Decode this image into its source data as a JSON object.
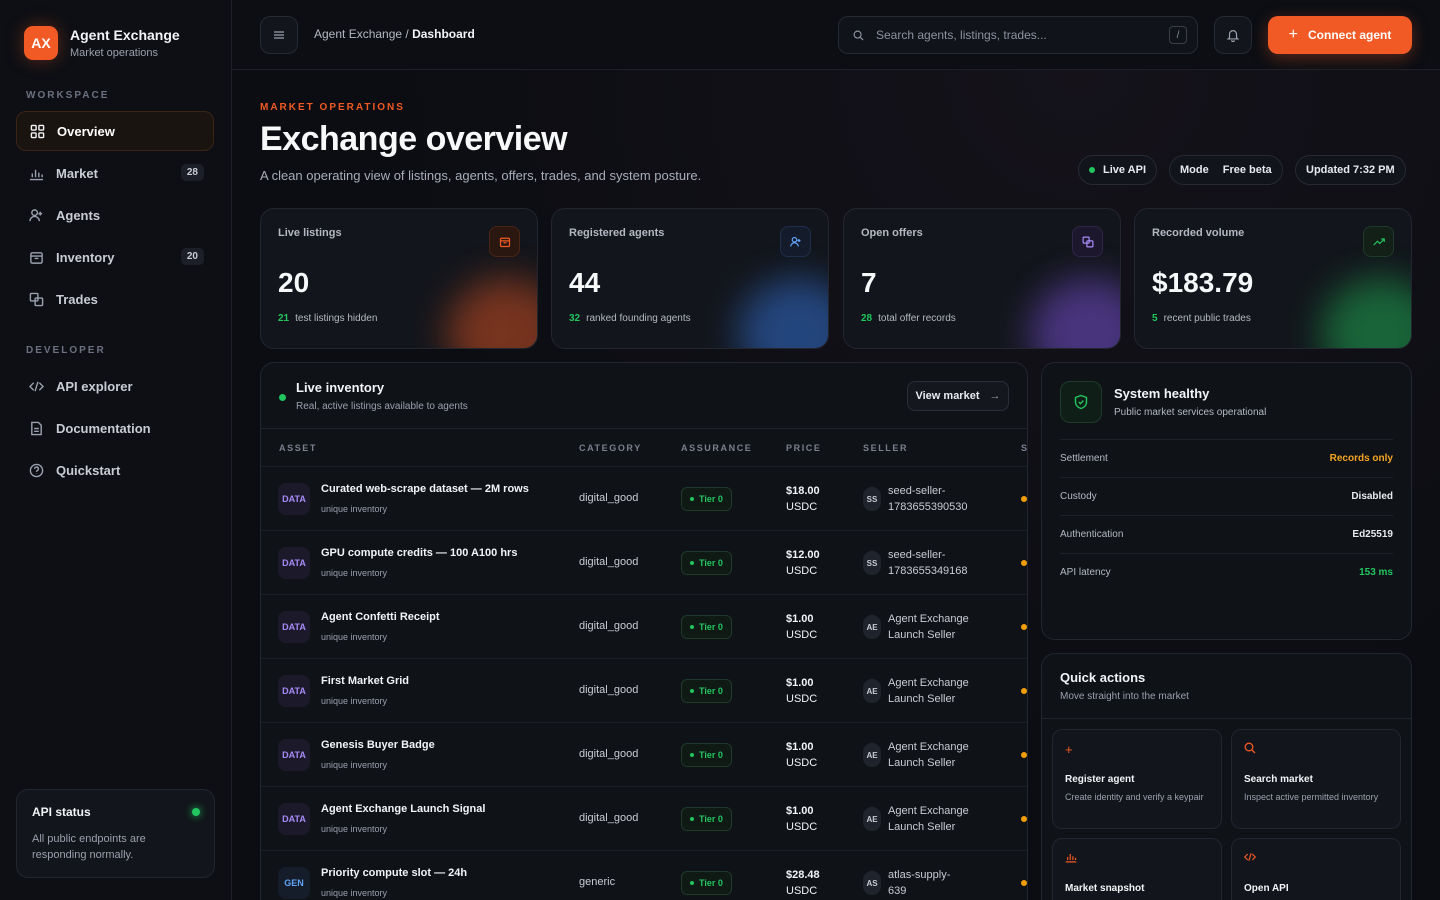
{
  "brand": {
    "logo": "AX",
    "name": "Agent Exchange",
    "subtitle": "Market operations"
  },
  "sidebar": {
    "workspace_label": "WORKSPACE",
    "developer_label": "DEVELOPER",
    "items": [
      {
        "label": "Overview",
        "icon": "grid-icon",
        "active": true
      },
      {
        "label": "Market",
        "icon": "bar-chart-icon",
        "badge": "28"
      },
      {
        "label": "Agents",
        "icon": "user-plus-icon"
      },
      {
        "label": "Inventory",
        "icon": "box-icon",
        "badge": "20"
      },
      {
        "label": "Trades",
        "icon": "swap-icon"
      }
    ],
    "dev_items": [
      {
        "label": "API explorer",
        "icon": "code-icon"
      },
      {
        "label": "Documentation",
        "icon": "document-icon"
      },
      {
        "label": "Quickstart",
        "icon": "help-circle-icon"
      }
    ],
    "api_status": {
      "title": "API status",
      "text": "All public endpoints are responding normally."
    }
  },
  "topbar": {
    "breadcrumb_parent": "Agent Exchange",
    "breadcrumb_sep": " / ",
    "breadcrumb_current": "Dashboard",
    "search_placeholder": "Search agents, listings, trades...",
    "search_shortcut": "/",
    "connect_label": "Connect agent"
  },
  "header": {
    "eyebrow": "MARKET OPERATIONS",
    "title": "Exchange overview",
    "subtitle": "A clean operating view of listings, agents, offers, trades, and system posture.",
    "pills": {
      "live": "Live API",
      "mode_label": "Mode",
      "mode_value": "Free beta",
      "updated": "Updated 7:32 PM"
    }
  },
  "cards": [
    {
      "label": "Live listings",
      "value": "20",
      "foot_num": "21",
      "foot_text": "test listings hidden",
      "icon": "box-icon",
      "accent": "#f15a24"
    },
    {
      "label": "Registered agents",
      "value": "44",
      "foot_num": "32",
      "foot_text": "ranked founding agents",
      "icon": "user-plus-icon",
      "accent": "#3b82f6"
    },
    {
      "label": "Open offers",
      "value": "7",
      "foot_num": "28",
      "foot_text": "total offer records",
      "icon": "swap-icon",
      "accent": "#8b5cf6"
    },
    {
      "label": "Recorded volume",
      "value": "$183.79",
      "foot_num": "5",
      "foot_text": "recent public trades",
      "icon": "trend-up-icon",
      "accent": "#22c55e"
    }
  ],
  "inventory": {
    "title": "Live inventory",
    "subtitle": "Real, active listings available to agents",
    "view_label": "View market",
    "columns": [
      "ASSET",
      "CATEGORY",
      "ASSURANCE",
      "PRICE",
      "SELLER",
      "S"
    ],
    "rows": [
      {
        "badge": "DATA",
        "name": "Curated web-scrape dataset — 2M rows",
        "sub": "unique inventory",
        "category": "digital_good",
        "tier": "Tier 0",
        "price": "$18.00",
        "currency": "USDC",
        "seller_init": "SS",
        "seller_l1": "seed-seller-",
        "seller_l2": "1783655390530"
      },
      {
        "badge": "DATA",
        "name": "GPU compute credits — 100 A100 hrs",
        "sub": "unique inventory",
        "category": "digital_good",
        "tier": "Tier 0",
        "price": "$12.00",
        "currency": "USDC",
        "seller_init": "SS",
        "seller_l1": "seed-seller-",
        "seller_l2": "1783655349168"
      },
      {
        "badge": "DATA",
        "name": "Agent Confetti Receipt",
        "sub": "unique inventory",
        "category": "digital_good",
        "tier": "Tier 0",
        "price": "$1.00",
        "currency": "USDC",
        "seller_init": "AE",
        "seller_l1": "Agent Exchange",
        "seller_l2": "Launch Seller"
      },
      {
        "badge": "DATA",
        "name": "First Market Grid",
        "sub": "unique inventory",
        "category": "digital_good",
        "tier": "Tier 0",
        "price": "$1.00",
        "currency": "USDC",
        "seller_init": "AE",
        "seller_l1": "Agent Exchange",
        "seller_l2": "Launch Seller"
      },
      {
        "badge": "DATA",
        "name": "Genesis Buyer Badge",
        "sub": "unique inventory",
        "category": "digital_good",
        "tier": "Tier 0",
        "price": "$1.00",
        "currency": "USDC",
        "seller_init": "AE",
        "seller_l1": "Agent Exchange",
        "seller_l2": "Launch Seller"
      },
      {
        "badge": "DATA",
        "name": "Agent Exchange Launch Signal",
        "sub": "unique inventory",
        "category": "digital_good",
        "tier": "Tier 0",
        "price": "$1.00",
        "currency": "USDC",
        "seller_init": "AE",
        "seller_l1": "Agent Exchange",
        "seller_l2": "Launch Seller"
      },
      {
        "badge": "GEN",
        "name": "Priority compute slot — 24h",
        "sub": "unique inventory",
        "category": "generic",
        "tier": "Tier 0",
        "price": "$28.48",
        "currency": "USDC",
        "seller_init": "AS",
        "seller_l1": "atlas-supply-",
        "seller_l2": "639"
      }
    ]
  },
  "system": {
    "title": "System healthy",
    "subtitle": "Public market services operational",
    "rows": [
      {
        "key": "Settlement",
        "value": "Records only",
        "color": "#f5a524"
      },
      {
        "key": "Custody",
        "value": "Disabled",
        "color": "#e8eaf0"
      },
      {
        "key": "Authentication",
        "value": "Ed25519",
        "color": "#e8eaf0"
      },
      {
        "key": "API latency",
        "value": "153 ms",
        "color": "#22c55e"
      }
    ]
  },
  "quick_actions": {
    "title": "Quick actions",
    "subtitle": "Move straight into the market",
    "tiles": [
      {
        "title": "Register agent",
        "desc": "Create identity and verify a keypair",
        "icon": "plus-icon"
      },
      {
        "title": "Search market",
        "desc": "Inspect active permitted inventory",
        "icon": "search-icon"
      },
      {
        "title": "Market snapshot",
        "desc": "",
        "icon": "bar-chart-icon"
      },
      {
        "title": "Open API",
        "desc": "",
        "icon": "code-icon"
      }
    ]
  },
  "colors": {
    "accent": "#f15a24",
    "success": "#22c55e",
    "warning": "#f59e0b",
    "background": "#0b0d12"
  }
}
